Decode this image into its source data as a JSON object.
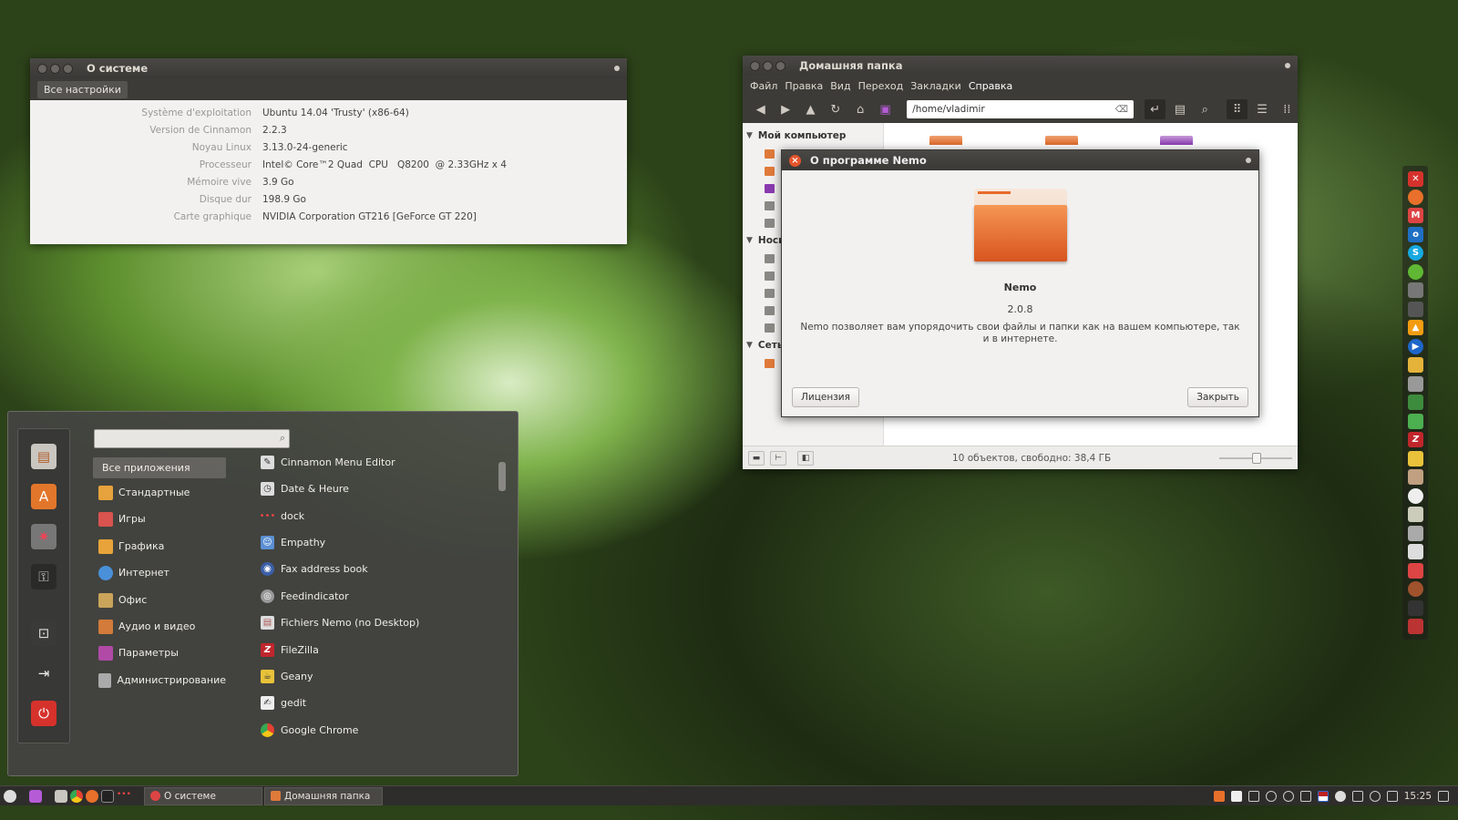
{
  "sysinfo": {
    "title": "О системе",
    "all_settings": "Все настройки",
    "rows": [
      {
        "key": "Système d'exploitation",
        "value": "Ubuntu 14.04 'Trusty' (x86-64)"
      },
      {
        "key": "Version de Cinnamon",
        "value": "2.2.3"
      },
      {
        "key": "Noyau Linux",
        "value": "3.13.0-24-generic"
      },
      {
        "key": "Processeur",
        "value": "Intel© Core™2 Quad  CPU   Q8200  @ 2.33GHz x 4"
      },
      {
        "key": "Mémoire vive",
        "value": "3.9 Go"
      },
      {
        "key": "Disque dur",
        "value": "198.9 Go"
      },
      {
        "key": "Carte graphique",
        "value": "NVIDIA Corporation GT216 [GeForce GT 220]"
      }
    ]
  },
  "nemo": {
    "title": "Домашняя папка",
    "menu": [
      "Файл",
      "Правка",
      "Вид",
      "Переход",
      "Закладки",
      "Справка"
    ],
    "path": "/home/vladimir",
    "sidebar": {
      "my_computer": "Мой компьютер",
      "devices": "Носи",
      "network": "Сеть"
    },
    "status": "10 объектов, свободно: 38,4 ГБ"
  },
  "about_nemo": {
    "title": "О программе Nemo",
    "app_name": "Nemo",
    "version": "2.0.8",
    "description": "Nemo позволяет вам упорядочить свои файлы и папки как на вашем компьютере, так и в интернете.",
    "license_button": "Лицензия",
    "close_button": "Закрыть"
  },
  "menu": {
    "search_value": "",
    "categories": [
      {
        "label": "Все приложения",
        "color": "#777"
      },
      {
        "label": "Стандартные",
        "color": "#e6a23c"
      },
      {
        "label": "Игры",
        "color": "#d9534f"
      },
      {
        "label": "Графика",
        "color": "#e8a43a"
      },
      {
        "label": "Интернет",
        "color": "#4a90d9"
      },
      {
        "label": "Офис",
        "color": "#caa45a"
      },
      {
        "label": "Аудио и видео",
        "color": "#d27b3a"
      },
      {
        "label": "Параметры",
        "color": "#b04aa6"
      },
      {
        "label": "Администрирование",
        "color": "#aaa"
      }
    ],
    "apps": [
      {
        "label": "Cinnamon Menu Editor",
        "color": "#ddd",
        "glyph": "✎"
      },
      {
        "label": "Date & Heure",
        "color": "#ddd",
        "glyph": "◷"
      },
      {
        "label": "dock",
        "color": "transparent",
        "glyph": "•••"
      },
      {
        "label": "Empathy",
        "color": "#5b8fd4",
        "glyph": "☺"
      },
      {
        "label": "Fax address book",
        "color": "#3b5fa8",
        "glyph": "◉"
      },
      {
        "label": "Feedindicator",
        "color": "#999",
        "glyph": "◎"
      },
      {
        "label": "Fichiers Nemo (no Desktop)",
        "color": "#ddd",
        "glyph": "▤"
      },
      {
        "label": "FileZilla",
        "color": "#c0262c",
        "glyph": "Z"
      },
      {
        "label": "Geany",
        "color": "#e8c23a",
        "glyph": "☕"
      },
      {
        "label": "gedit",
        "color": "#eee",
        "glyph": "✍"
      },
      {
        "label": "Google Chrome",
        "color": "#e34133",
        "glyph": "◍"
      }
    ]
  },
  "taskbar": {
    "tasks": [
      "О системе",
      "Домашняя папка"
    ],
    "clock": "15:25"
  },
  "colors": {
    "accent": "#dd4814",
    "folder": "#e8743a"
  }
}
